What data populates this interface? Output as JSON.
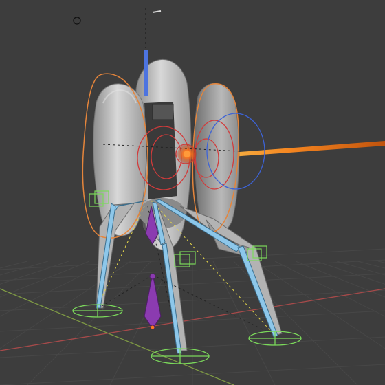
{
  "app": {
    "title": ""
  },
  "viewport": {
    "background": "#3d3d3d",
    "grid_color": "#474747",
    "x_axis_color": "#a64a4a",
    "y_axis_color": "#7f9a44"
  },
  "colors": {
    "turret_body": "#c7c7c7",
    "turret_dark": "#7d7d7d",
    "leg_bone": "#8dc7ea",
    "ik_circle": "#7bd95b",
    "custom_shape_orange": "#e5853b",
    "custom_shape_red": "#d23b3b",
    "custom_shape_blue": "#3d63d6",
    "laser": "#ff7a1f",
    "gun_bone": "#4d74e0",
    "root_bone": "#8b3bb0"
  },
  "icons": {
    "light_gizmo": "circle-outline-icon",
    "camera_gizmo": "camera-top-icon"
  },
  "objects": [
    {
      "name": "turret-body",
      "type": "mesh"
    },
    {
      "name": "armature-legs",
      "type": "armature"
    },
    {
      "name": "armature-controls",
      "type": "custom-shapes"
    },
    {
      "name": "laser-beam",
      "type": "mesh"
    }
  ]
}
